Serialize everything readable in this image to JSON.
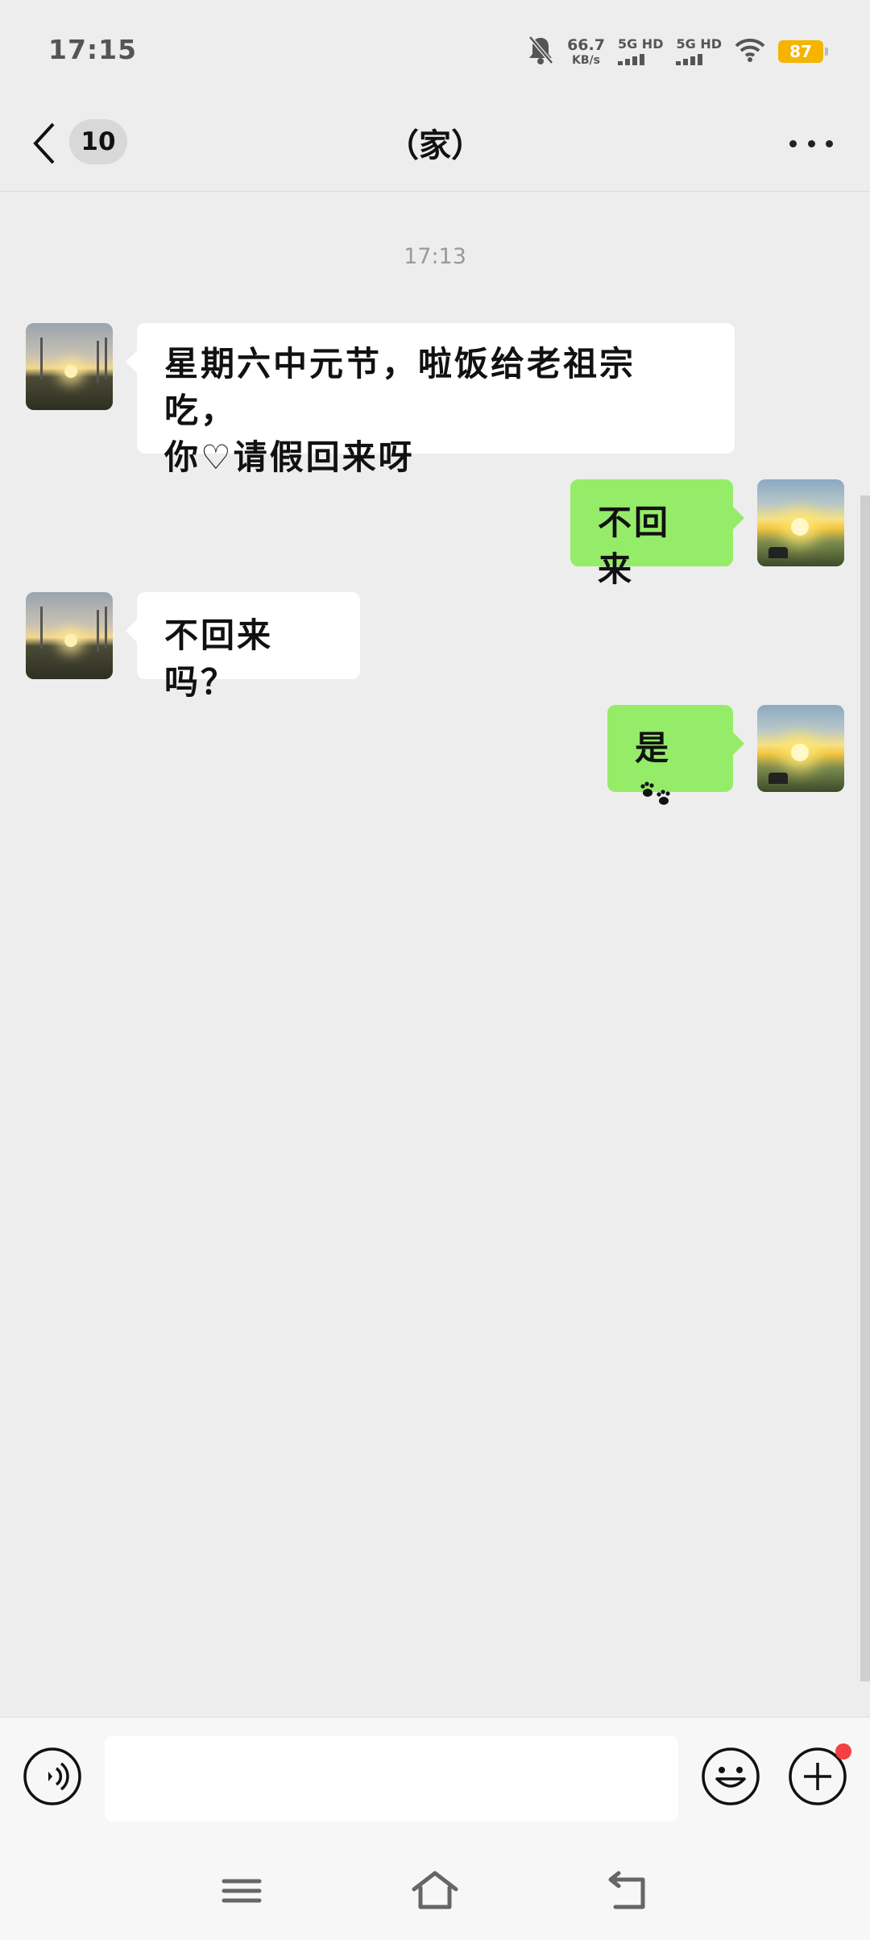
{
  "status_bar": {
    "time": "17:15",
    "net_speed_value": "66.7",
    "net_speed_unit": "KB/s",
    "sim1_label": "5G HD",
    "sim2_label": "5G HD",
    "battery": "87",
    "icons": [
      "bell-muted-icon",
      "signal-icon",
      "signal-icon",
      "wifi-icon",
      "battery-icon"
    ]
  },
  "nav": {
    "unread_count": "10",
    "title": "（家）",
    "icons": [
      "back-chevron-icon",
      "more-dots-icon"
    ]
  },
  "chat": {
    "time_divider": "17:13",
    "messages": [
      {
        "from": "other",
        "text": "星期六中元节，啦饭给老祖宗吃，\n你♡请假回来呀"
      },
      {
        "from": "me",
        "text": "不回来"
      },
      {
        "from": "other",
        "text": "不回来吗？"
      },
      {
        "from": "me",
        "text": "是",
        "trailing_icon": "paw-prints-icon"
      }
    ]
  },
  "input_bar": {
    "value": "",
    "icons": [
      "voice-icon",
      "emoji-icon",
      "plus-icon"
    ],
    "notification_dot_color": "#f44040"
  },
  "system_nav": {
    "icons": [
      "menu-icon",
      "home-icon",
      "back-icon"
    ]
  },
  "colors": {
    "background": "#ededed",
    "outgoing_bubble": "#95ec69",
    "incoming_bubble": "#ffffff",
    "battery": "#f4b400"
  }
}
